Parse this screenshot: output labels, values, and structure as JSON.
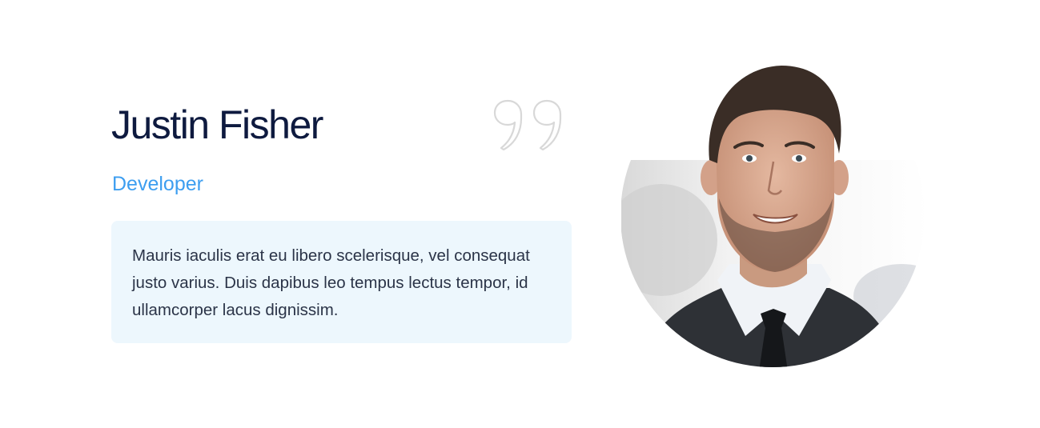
{
  "testimonial": {
    "name": "Justin Fisher",
    "role": "Developer",
    "quote": "Mauris iaculis erat eu libero scelerisque, vel consequat justo varius. Duis dapibus leo tempus lectus tempor, id ullamcorper lacus dignissim."
  },
  "icons": {
    "quote": "quote-icon",
    "photo": "person-photo"
  },
  "colors": {
    "name": "#0e1a3f",
    "role": "#3d9ef0",
    "quote_box_bg": "#edf7fd",
    "quote_text": "#2b3448",
    "quote_icon": "#d8d8d8"
  }
}
